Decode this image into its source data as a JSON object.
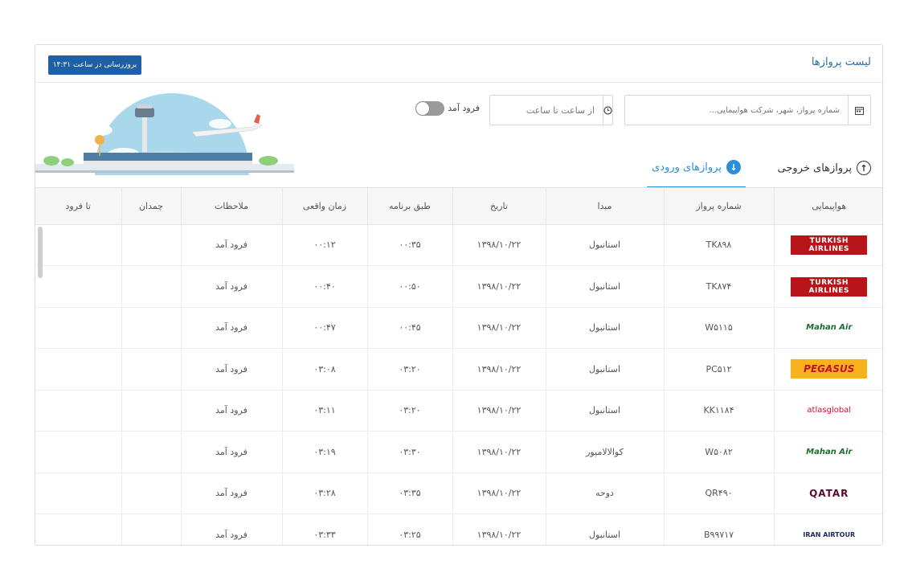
{
  "header": {
    "title": "لیست پروازها",
    "refresh_label": "بروزرسانی در ساعت ۱۴:۳۱"
  },
  "filters": {
    "search_placeholder": "شماره پرواز، شهر، شرکت هواپیمایی...",
    "time_placeholder": "از ساعت تا ساعت",
    "toggle_label": "فرود آمد",
    "toggle_on": false
  },
  "tabs": {
    "outgoing": "پروازهای خروجی",
    "incoming": "پروازهای ورودی",
    "active": "incoming"
  },
  "table": {
    "columns": [
      "هواپیمایی",
      "شماره پرواز",
      "مبدا",
      "تاریخ",
      "طبق برنامه",
      "زمان واقعی",
      "ملاحظات",
      "چمدان",
      "تا فرود"
    ],
    "rows": [
      {
        "airline": "TURKISH AIRLINES",
        "logo": "turkish",
        "flight": "TK۸۹۸",
        "origin": "استانبول",
        "date": "۱۳۹۸/۱۰/۲۲",
        "scheduled": "۰۰:۳۵",
        "actual": "۰۰:۱۲",
        "status": "فرود آمد",
        "baggage": "",
        "eta": ""
      },
      {
        "airline": "TURKISH AIRLINES",
        "logo": "turkish",
        "flight": "TK۸۷۴",
        "origin": "استانبول",
        "date": "۱۳۹۸/۱۰/۲۲",
        "scheduled": "۰۰:۵۰",
        "actual": "۰۰:۴۰",
        "status": "فرود آمد",
        "baggage": "",
        "eta": ""
      },
      {
        "airline": "Mahan Air",
        "logo": "mahan",
        "flight": "W۵۱۱۵",
        "origin": "استانبول",
        "date": "۱۳۹۸/۱۰/۲۲",
        "scheduled": "۰۰:۴۵",
        "actual": "۰۰:۴۷",
        "status": "فرود آمد",
        "baggage": "",
        "eta": ""
      },
      {
        "airline": "PEGASUS",
        "logo": "pegasus",
        "flight": "PC۵۱۲",
        "origin": "استانبول",
        "date": "۱۳۹۸/۱۰/۲۲",
        "scheduled": "۰۳:۲۰",
        "actual": "۰۳:۰۸",
        "status": "فرود آمد",
        "baggage": "",
        "eta": ""
      },
      {
        "airline": "atlasglobal",
        "logo": "atlas",
        "flight": "KK۱۱۸۴",
        "origin": "استانبول",
        "date": "۱۳۹۸/۱۰/۲۲",
        "scheduled": "۰۳:۲۰",
        "actual": "۰۳:۱۱",
        "status": "فرود آمد",
        "baggage": "",
        "eta": ""
      },
      {
        "airline": "Mahan Air",
        "logo": "mahan",
        "flight": "W۵۰۸۲",
        "origin": "کوالالامپور",
        "date": "۱۳۹۸/۱۰/۲۲",
        "scheduled": "۰۳:۳۰",
        "actual": "۰۳:۱۹",
        "status": "فرود آمد",
        "baggage": "",
        "eta": ""
      },
      {
        "airline": "QATAR",
        "logo": "qatar",
        "flight": "QR۴۹۰",
        "origin": "دوحه",
        "date": "۱۳۹۸/۱۰/۲۲",
        "scheduled": "۰۳:۳۵",
        "actual": "۰۳:۲۸",
        "status": "فرود آمد",
        "baggage": "",
        "eta": ""
      },
      {
        "airline": "IRAN AIRTOUR",
        "logo": "iranair",
        "flight": "B۹۹۷۱۷",
        "origin": "استانبول",
        "date": "۱۳۹۸/۱۰/۲۲",
        "scheduled": "۰۳:۲۵",
        "actual": "۰۳:۳۳",
        "status": "فرود آمد",
        "baggage": "",
        "eta": ""
      }
    ]
  },
  "colors": {
    "primary_button": "#1f5fa6",
    "active_tab": "#2f8fd6",
    "title": "#2b6ca3"
  }
}
